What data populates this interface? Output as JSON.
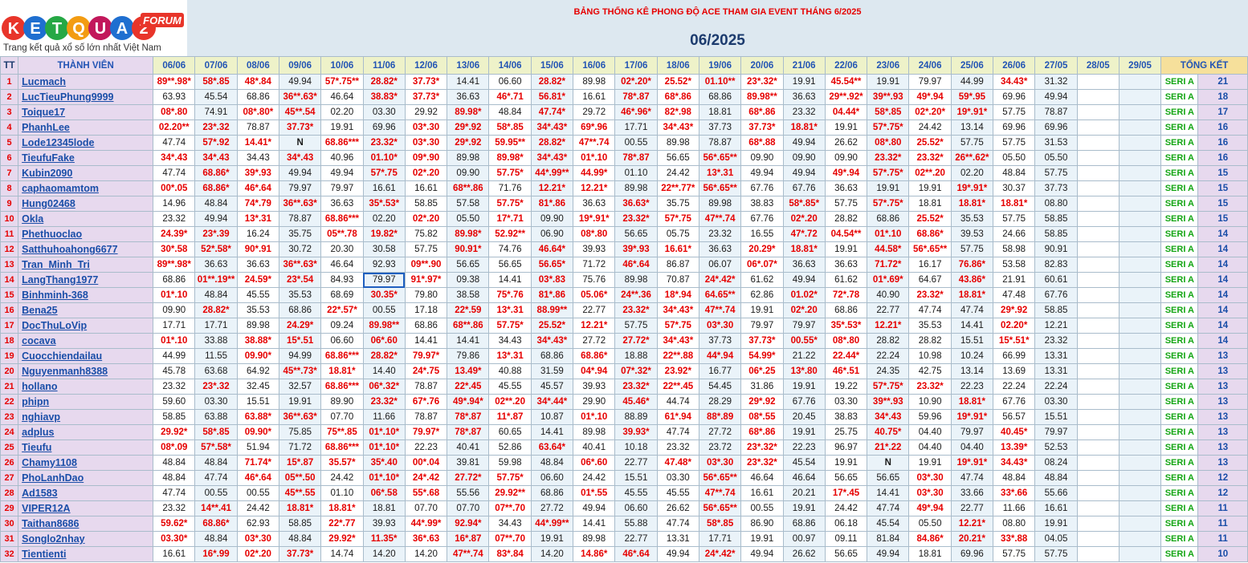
{
  "banner": {
    "title": "BẢNG THỐNG KÊ PHONG ĐỘ ACE THAM GIA EVENT THÁNG 6/2025",
    "month": "06/2025"
  },
  "logo": {
    "brand_letters": [
      "K",
      "E",
      "T",
      "Q",
      "U",
      "A"
    ],
    "brand_number": "2",
    "forum_label": "FORUM",
    "tagline": "Trang kết quả xổ số lớn nhất Việt Nam",
    "colors": [
      "#e8352a",
      "#1f6fd0",
      "#26a845",
      "#f39c12",
      "#c2185b",
      "#1f6fd0"
    ]
  },
  "headers": {
    "tt": "TT",
    "member": "THÀNH VIÊN",
    "total": "TỔNG KẾT"
  },
  "dates": [
    "06/06",
    "07/06",
    "08/06",
    "09/06",
    "10/06",
    "11/06",
    "12/06",
    "13/06",
    "14/06",
    "15/06",
    "16/06",
    "17/06",
    "18/06",
    "19/06",
    "20/06",
    "21/06",
    "22/06",
    "23/06",
    "24/06",
    "25/06",
    "26/06",
    "27/05",
    "28/05",
    "29/05"
  ],
  "rows": [
    {
      "tt": "1",
      "name": "Lucmach",
      "seri": "SERI A",
      "score": "21",
      "v": [
        "89**.98*",
        "58*.85",
        "48*.84",
        "49.94",
        "57*.75**",
        "28.82*",
        "37.73*",
        "14.41",
        "06.60",
        "28.82*",
        "89.98",
        "02*.20*",
        "25.52*",
        "01.10**",
        "23*.32*",
        "19.91",
        "45.54**",
        "19.91",
        "79.97",
        "44.99",
        "34.43*",
        "31.32",
        "",
        ""
      ]
    },
    {
      "tt": "2",
      "name": "LucTieuPhung9999",
      "seri": "SERI A",
      "score": "18",
      "v": [
        "63.93",
        "45.54",
        "68.86",
        "36**.63*",
        "46.64",
        "38.83*",
        "37.73*",
        "36.63",
        "46*.71",
        "56.81*",
        "16.61",
        "78*.87",
        "68*.86",
        "68.86",
        "89.98**",
        "36.63",
        "29**.92*",
        "39**.93",
        "49*.94",
        "59*.95",
        "69.96",
        "49.94",
        "",
        ""
      ]
    },
    {
      "tt": "3",
      "name": "Toique17",
      "seri": "SERI A",
      "score": "17",
      "v": [
        "08*.80",
        "74.91",
        "08*.80*",
        "45**.54",
        "02.20",
        "03.30",
        "29.92",
        "89.98*",
        "48.84",
        "47.74*",
        "29.72",
        "46*.96*",
        "82*.98",
        "18.81",
        "68*.86",
        "23.32",
        "04.44*",
        "58*.85",
        "02*.20*",
        "19*.91*",
        "57.75",
        "78.87",
        "",
        ""
      ]
    },
    {
      "tt": "4",
      "name": "PhanhLee",
      "seri": "SERI A",
      "score": "16",
      "v": [
        "02.20**",
        "23*.32",
        "78.87",
        "37.73*",
        "19.91",
        "69.96",
        "03*.30",
        "29*.92",
        "58*.85",
        "34*.43*",
        "69*.96",
        "17.71",
        "34*.43*",
        "37.73",
        "37.73*",
        "18.81*",
        "19.91",
        "57*.75*",
        "24.42",
        "13.14",
        "69.96",
        "69.96",
        "",
        ""
      ]
    },
    {
      "tt": "5",
      "name": "Lode12345lode",
      "seri": "SERI A",
      "score": "16",
      "v": [
        "47.74",
        "57*.92",
        "14.41*",
        "N",
        "68.86***",
        "23.32*",
        "03*.30",
        "29*.92",
        "59.95**",
        "28.82*",
        "47**.74",
        "00.55",
        "89.98",
        "78.87",
        "68*.88",
        "49.94",
        "26.62",
        "08*.80",
        "25.52*",
        "57.75",
        "57.75",
        "31.53",
        "",
        ""
      ]
    },
    {
      "tt": "6",
      "name": "TieufuFake",
      "seri": "SERI A",
      "score": "16",
      "v": [
        "34*.43",
        "34*.43",
        "34.43",
        "34*.43",
        "40.96",
        "01.10*",
        "09*.90",
        "89.98",
        "89.98*",
        "34*.43*",
        "01*.10",
        "78*.87",
        "56.65",
        "56*.65**",
        "09.90",
        "09.90",
        "09.90",
        "23.32*",
        "23.32*",
        "26**.62*",
        "05.50",
        "05.50",
        "",
        ""
      ]
    },
    {
      "tt": "7",
      "name": "Kubin2090",
      "seri": "SERI A",
      "score": "15",
      "v": [
        "47.74",
        "68.86*",
        "39*.93",
        "49.94",
        "49.94",
        "57*.75",
        "02*.20",
        "09.90",
        "57.75*",
        "44*.99**",
        "44.99*",
        "01.10",
        "24.42",
        "13*.31",
        "49.94",
        "49.94",
        "49*.94",
        "57*.75*",
        "02**.20",
        "02.20",
        "48.84",
        "57.75",
        "",
        ""
      ]
    },
    {
      "tt": "8",
      "name": "caphaomamtom",
      "seri": "SERI A",
      "score": "15",
      "v": [
        "00*.05",
        "68.86*",
        "46*.64",
        "79.97",
        "79.97",
        "16.61",
        "16.61",
        "68**.86",
        "71.76",
        "12.21*",
        "12.21*",
        "89.98",
        "22**.77*",
        "56*.65**",
        "67.76",
        "67.76",
        "36.63",
        "19.91",
        "19.91",
        "19*.91*",
        "30.37",
        "37.73",
        "",
        ""
      ]
    },
    {
      "tt": "9",
      "name": "Hung02468",
      "seri": "SERI A",
      "score": "15",
      "v": [
        "14.96",
        "48.84",
        "74*.79",
        "36**.63*",
        "36.63",
        "35*.53*",
        "58.85",
        "57.58",
        "57.75*",
        "81*.86",
        "36.63",
        "36.63*",
        "35.75",
        "89.98",
        "38.83",
        "58*.85*",
        "57.75",
        "57*.75*",
        "18.81",
        "18.81*",
        "18.81*",
        "08.80",
        "",
        ""
      ]
    },
    {
      "tt": "10",
      "name": "Okla",
      "seri": "SERI A",
      "score": "15",
      "v": [
        "23.32",
        "49.94",
        "13*.31",
        "78.87",
        "68.86***",
        "02.20",
        "02*.20",
        "05.50",
        "17*.71",
        "09.90",
        "19*.91*",
        "23.32*",
        "57*.75",
        "47**.74",
        "67.76",
        "02*.20",
        "28.82",
        "68.86",
        "25.52*",
        "35.53",
        "57.75",
        "58.85",
        "",
        ""
      ]
    },
    {
      "tt": "11",
      "name": "Phethuoclao",
      "seri": "SERI A",
      "score": "14",
      "v": [
        "24.39*",
        "23*.39",
        "16.24",
        "35.75",
        "05**.78",
        "19.82*",
        "75.82",
        "89.98*",
        "52.92**",
        "06.90",
        "08*.80",
        "56.65",
        "05.75",
        "23.32",
        "16.55",
        "47*.72",
        "04.54**",
        "01*.10",
        "68.86*",
        "39.53",
        "24.66",
        "58.85",
        "",
        ""
      ]
    },
    {
      "tt": "12",
      "name": "Satthuhoahong6677",
      "seri": "SERI A",
      "score": "14",
      "v": [
        "30*.58",
        "52*.58*",
        "90*.91",
        "30.72",
        "20.30",
        "30.58",
        "57.75",
        "90.91*",
        "74.76",
        "46.64*",
        "39.93",
        "39*.93",
        "16.61*",
        "36.63",
        "20.29*",
        "18.81*",
        "19.91",
        "44.58*",
        "56*.65**",
        "57.75",
        "58.98",
        "90.91",
        "",
        ""
      ]
    },
    {
      "tt": "13",
      "name": "Tran_Minh_Tri",
      "seri": "SERI A",
      "score": "14",
      "v": [
        "89**.98*",
        "36.63",
        "36.63",
        "36**.63*",
        "46.64",
        "92.93",
        "09**.90",
        "56.65",
        "56.65",
        "56.65*",
        "71.72",
        "46*.64",
        "86.87",
        "06.07",
        "06*.07*",
        "36.63",
        "36.63",
        "71.72*",
        "16.17",
        "76.86*",
        "53.58",
        "82.83",
        "",
        ""
      ]
    },
    {
      "tt": "14",
      "name": "LangThang1977",
      "seri": "SERI A",
      "score": "14",
      "v": [
        "68.86",
        "01**.19**",
        "24.59*",
        "23*.54",
        "84.93",
        "79.97",
        "91*.97*",
        "09.38",
        "14.41",
        "03*.83",
        "75.76",
        "89.98",
        "70.87",
        "24*.42*",
        "61.62",
        "49.94",
        "61.62",
        "01*.69*",
        "64.67",
        "43.86*",
        "21.91",
        "60.61",
        "",
        ""
      ]
    },
    {
      "tt": "15",
      "name": "Binhminh-368",
      "seri": "SERI A",
      "score": "14",
      "v": [
        "01*.10",
        "48.84",
        "45.55",
        "35.53",
        "68.69",
        "30.35*",
        "79.80",
        "38.58",
        "75*.76",
        "81*.86",
        "05.06*",
        "24**.36",
        "18*.94",
        "64.65**",
        "62.86",
        "01.02*",
        "72*.78",
        "40.90",
        "23.32*",
        "18.81*",
        "47.48",
        "67.76",
        "",
        ""
      ]
    },
    {
      "tt": "16",
      "name": "Bena25",
      "seri": "SERI A",
      "score": "14",
      "v": [
        "09.90",
        "28.82*",
        "35.53",
        "68.86",
        "22*.57*",
        "00.55",
        "17.18",
        "22*.59",
        "13*.31",
        "88.99**",
        "22.77",
        "23.32*",
        "34*.43*",
        "47**.74",
        "19.91",
        "02*.20",
        "68.86",
        "22.77",
        "47.74",
        "47.74",
        "29*.92",
        "58.85",
        "",
        ""
      ]
    },
    {
      "tt": "17",
      "name": "DocThuLoVip",
      "seri": "SERI A",
      "score": "14",
      "v": [
        "17.71",
        "17.71",
        "89.98",
        "24.29*",
        "09.24",
        "89.98**",
        "68.86",
        "68**.86",
        "57.75*",
        "25.52*",
        "12.21*",
        "57.75",
        "57*.75",
        "03*.30",
        "79.97",
        "79.97",
        "35*.53*",
        "12.21*",
        "35.53",
        "14.41",
        "02.20*",
        "12.21",
        "",
        ""
      ]
    },
    {
      "tt": "18",
      "name": "cocava",
      "seri": "SERI A",
      "score": "14",
      "v": [
        "01*.10",
        "33.88",
        "38.88*",
        "15*.51",
        "06.60",
        "06*.60",
        "14.41",
        "14.41",
        "34.43",
        "34*.43*",
        "27.72",
        "27.72*",
        "34*.43*",
        "37.73",
        "37.73*",
        "00.55*",
        "08*.80",
        "28.82",
        "28.82",
        "15.51",
        "15*.51*",
        "23.32",
        "",
        ""
      ]
    },
    {
      "tt": "19",
      "name": "Cuocchiendailau",
      "seri": "SERI A",
      "score": "13",
      "v": [
        "44.99",
        "11.55",
        "09.90*",
        "94.99",
        "68.86***",
        "28.82*",
        "79.97*",
        "79.86",
        "13*.31",
        "68.86",
        "68.86*",
        "18.88",
        "22**.88",
        "44*.94",
        "54.99*",
        "21.22",
        "22.44*",
        "22.24",
        "10.98",
        "10.24",
        "66.99",
        "13.31",
        "",
        ""
      ]
    },
    {
      "tt": "20",
      "name": "Nguyenmanh8388",
      "seri": "SERI A",
      "score": "13",
      "v": [
        "45.78",
        "63.68",
        "64.92",
        "45**.73*",
        "18.81*",
        "14.40",
        "24*.75",
        "13.49*",
        "40.88",
        "31.59",
        "04*.94",
        "07*.32*",
        "23.92*",
        "16.77",
        "06*.25",
        "13*.80",
        "46*.51",
        "24.35",
        "42.75",
        "13.14",
        "13.69",
        "13.31",
        "",
        ""
      ]
    },
    {
      "tt": "21",
      "name": "hollano",
      "seri": "SERI A",
      "score": "13",
      "v": [
        "23.32",
        "23*.32",
        "32.45",
        "32.57",
        "68.86***",
        "06*.32*",
        "78.87",
        "22*.45",
        "45.55",
        "45.57",
        "39.93",
        "23.32*",
        "22**.45",
        "54.45",
        "31.86",
        "19.91",
        "19.22",
        "57*.75*",
        "23.32*",
        "22.23",
        "22.24",
        "22.24",
        "",
        ""
      ]
    },
    {
      "tt": "22",
      "name": "phipn",
      "seri": "SERI A",
      "score": "13",
      "v": [
        "59.60",
        "03.30",
        "15.51",
        "19.91",
        "89.90",
        "23.32*",
        "67*.76",
        "49*.94*",
        "02**.20",
        "34*.44*",
        "29.90",
        "45.46*",
        "44.74",
        "28.29",
        "29*.92",
        "67.76",
        "03.30",
        "39**.93",
        "10.90",
        "18.81*",
        "67.76",
        "03.30",
        "",
        ""
      ]
    },
    {
      "tt": "23",
      "name": "nghiavp",
      "seri": "SERI A",
      "score": "13",
      "v": [
        "58.85",
        "63.88",
        "63.88*",
        "36**.63*",
        "07.70",
        "11.66",
        "78.87",
        "78*.87",
        "11*.87",
        "10.87",
        "01*.10",
        "88.89",
        "61*.94",
        "88*.89",
        "08*.55",
        "20.45",
        "38.83",
        "34*.43",
        "59.96",
        "19*.91*",
        "56.57",
        "15.51",
        "",
        ""
      ]
    },
    {
      "tt": "24",
      "name": "adplus",
      "seri": "SERI A",
      "score": "13",
      "v": [
        "29.92*",
        "58*.85",
        "09.90*",
        "75.85",
        "75**.85",
        "01*.10*",
        "79.97*",
        "78*.87",
        "60.65",
        "14.41",
        "89.98",
        "39.93*",
        "47.74",
        "27.72",
        "68*.86",
        "19.91",
        "25.75",
        "40.75*",
        "04.40",
        "79.97",
        "40.45*",
        "79.97",
        "",
        ""
      ]
    },
    {
      "tt": "25",
      "name": "Tieufu",
      "seri": "SERI A",
      "score": "13",
      "v": [
        "08*.09",
        "57*.58*",
        "51.94",
        "71.72",
        "68.86***",
        "01*.10*",
        "22.23",
        "40.41",
        "52.86",
        "63.64*",
        "40.41",
        "10.18",
        "23.32",
        "23.72",
        "23*.32*",
        "22.23",
        "96.97",
        "21*.22",
        "04.40",
        "04.40",
        "13.39*",
        "52.53",
        "",
        ""
      ]
    },
    {
      "tt": "26",
      "name": "Chamy1108",
      "seri": "SERI A",
      "score": "13",
      "v": [
        "48.84",
        "48.84",
        "71.74*",
        "15*.87",
        "35.57*",
        "35*.40",
        "00*.04",
        "39.81",
        "59.98",
        "48.84",
        "06*.60",
        "22.77",
        "47.48*",
        "03*.30",
        "23*.32*",
        "45.54",
        "19.91",
        "N",
        "19.91",
        "19*.91*",
        "34.43*",
        "08.24",
        "",
        ""
      ]
    },
    {
      "tt": "27",
      "name": "PhoLanhDao",
      "seri": "SERI A",
      "score": "12",
      "v": [
        "48.84",
        "47.74",
        "46*.64",
        "05**.50",
        "24.42",
        "01*.10*",
        "24*.42",
        "27.72*",
        "57.75*",
        "06.60",
        "24.42",
        "15.51",
        "03.30",
        "56*.65**",
        "46.64",
        "46.64",
        "56.65",
        "56.65",
        "03*.30",
        "47.74",
        "48.84",
        "48.84",
        "",
        ""
      ]
    },
    {
      "tt": "28",
      "name": "Ad1583",
      "seri": "SERI A",
      "score": "12",
      "v": [
        "47.74",
        "00.55",
        "00.55",
        "45**.55",
        "01.10",
        "06*.58",
        "55*.68",
        "55.56",
        "29.92**",
        "68.86",
        "01*.55",
        "45.55",
        "45.55",
        "47**.74",
        "16.61",
        "20.21",
        "17*.45",
        "14.41",
        "03*.30",
        "33.66",
        "33*.66",
        "55.66",
        "",
        ""
      ]
    },
    {
      "tt": "29",
      "name": "VIPER12A",
      "seri": "SERI A",
      "score": "11",
      "v": [
        "23.32",
        "14**.41",
        "24.42",
        "18.81*",
        "18.81*",
        "18.81",
        "07.70",
        "07.70",
        "07**.70",
        "27.72",
        "49.94",
        "06.60",
        "26.62",
        "56*.65**",
        "00.55",
        "19.91",
        "24.42",
        "47.74",
        "49*.94",
        "22.77",
        "11.66",
        "16.61",
        "",
        ""
      ]
    },
    {
      "tt": "30",
      "name": "Taithan8686",
      "seri": "SERI A",
      "score": "11",
      "v": [
        "59.62*",
        "68.86*",
        "62.93",
        "58.85",
        "22*.77",
        "39.93",
        "44*.99*",
        "92.94*",
        "34.43",
        "44*.99**",
        "14.41",
        "55.88",
        "47.74",
        "58*.85",
        "86.90",
        "68.86",
        "06.18",
        "45.54",
        "05.50",
        "12.21*",
        "08.80",
        "19.91",
        "",
        ""
      ]
    },
    {
      "tt": "31",
      "name": "Songlo2nhay",
      "seri": "SERI A",
      "score": "11",
      "v": [
        "03.30*",
        "48.84",
        "03*.30",
        "48.84",
        "29.92*",
        "11.35*",
        "36*.63",
        "16*.87",
        "07**.70",
        "19.91",
        "89.98",
        "22.77",
        "13.31",
        "17.71",
        "19.91",
        "00.97",
        "09.11",
        "81.84",
        "84.86*",
        "20.21*",
        "33*.88",
        "04.05",
        "",
        ""
      ]
    },
    {
      "tt": "32",
      "name": "Tientienti",
      "seri": "SERI A",
      "score": "10",
      "v": [
        "16.61",
        "16*.99",
        "02*.20",
        "37.73*",
        "14.74",
        "14.20",
        "14.20",
        "47**.74",
        "83*.84",
        "14.20",
        "14.86*",
        "46*.64",
        "49.94",
        "24*.42*",
        "49.94",
        "26.62",
        "56.65",
        "49.94",
        "18.81",
        "69.96",
        "57.75",
        "57.75",
        "",
        ""
      ]
    }
  ]
}
